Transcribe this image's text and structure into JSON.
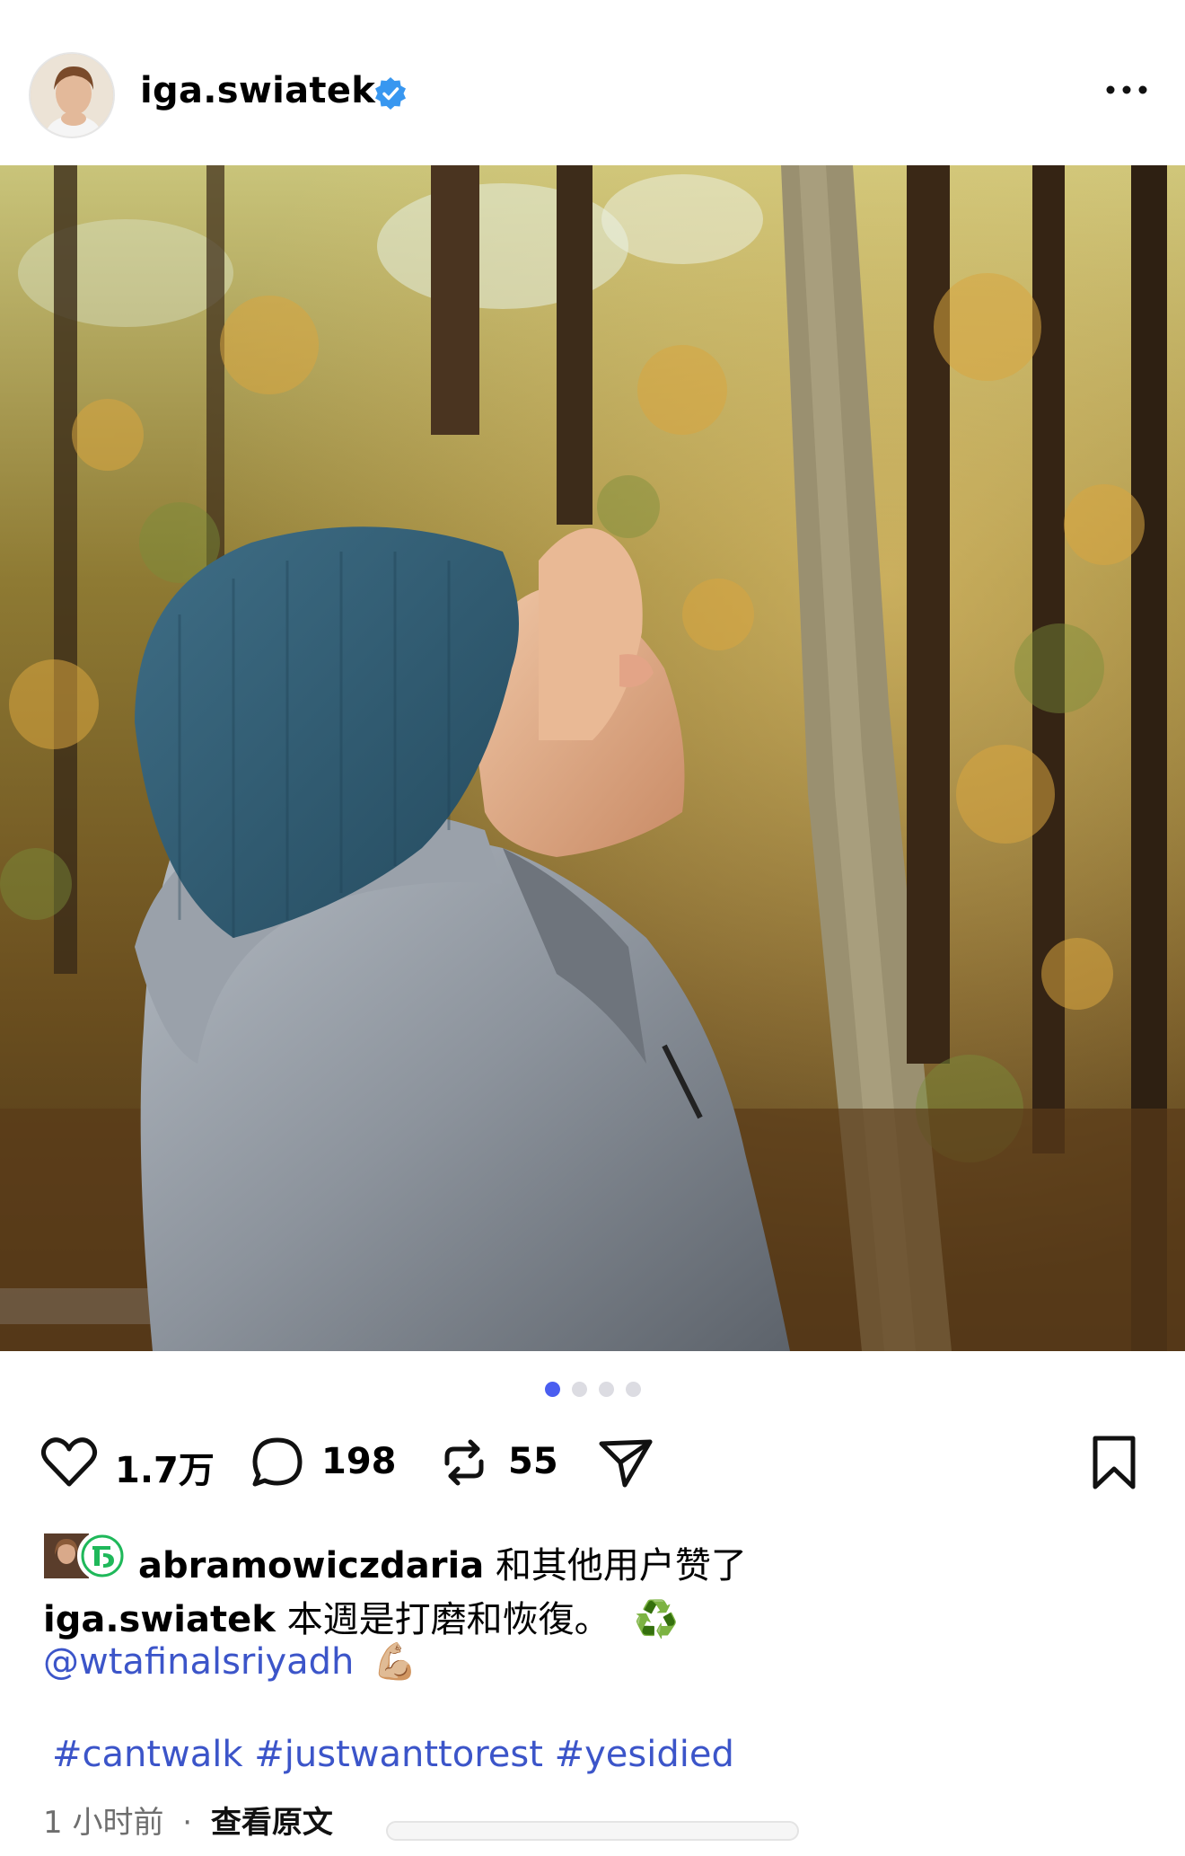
{
  "post": {
    "author": "iga.swiatek",
    "verified": true,
    "avatar_icon": "profile-avatar",
    "more_icon": "more-horizontal-icon"
  },
  "carousel": {
    "total": 4,
    "current": 1
  },
  "actions": {
    "likes": "1.7万",
    "comments": "198",
    "reposts": "55"
  },
  "liked_by": {
    "user": "abramowiczdaria",
    "suffix": "和其他用户赞了"
  },
  "caption": {
    "author": "iga.swiatek",
    "text": "本週是打磨和恢復。",
    "emoji1": "♻️",
    "mention": "@wtafinalsriyadh",
    "emoji2": "💪🏼",
    "hashtags": "#cantwalk #justwanttorest #yesidied"
  },
  "meta": {
    "time": "1 小时前",
    "separator": "·",
    "translate": "查看原文"
  },
  "colors": {
    "link": "#3c55c9",
    "active_dot": "#4a5ef0",
    "verified": "#3897f0"
  }
}
